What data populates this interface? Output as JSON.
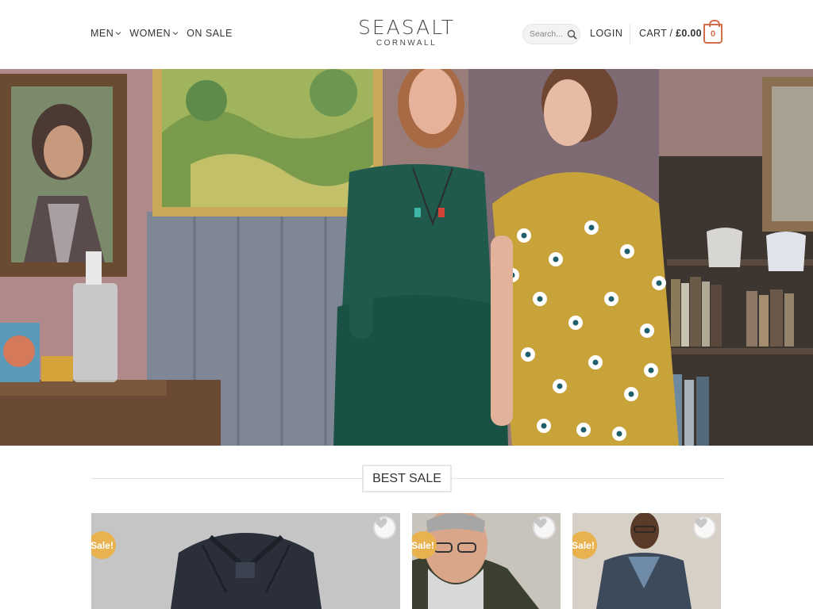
{
  "nav": {
    "items": [
      {
        "label": "MEN",
        "dropdown": true
      },
      {
        "label": "WOMEN",
        "dropdown": true
      },
      {
        "label": "ON SALE",
        "dropdown": false
      }
    ]
  },
  "logo": {
    "main": "SEASALT",
    "sub": "CORNWALL"
  },
  "search": {
    "placeholder": "Search..."
  },
  "account": {
    "login_label": "LOGIN"
  },
  "cart": {
    "label": "CART /",
    "amount": "£0.00",
    "count": "0"
  },
  "section": {
    "title": "BEST SALE"
  },
  "products": [
    {
      "sale_label": "Sale!",
      "wishlist_icon": "heart-icon"
    },
    {
      "sale_label": "Sale!",
      "wishlist_icon": "heart-icon"
    },
    {
      "sale_label": "Sale!",
      "wishlist_icon": "heart-icon"
    }
  ],
  "colors": {
    "accent": "#d26e4b",
    "sale_badge": "#e8b24f"
  }
}
